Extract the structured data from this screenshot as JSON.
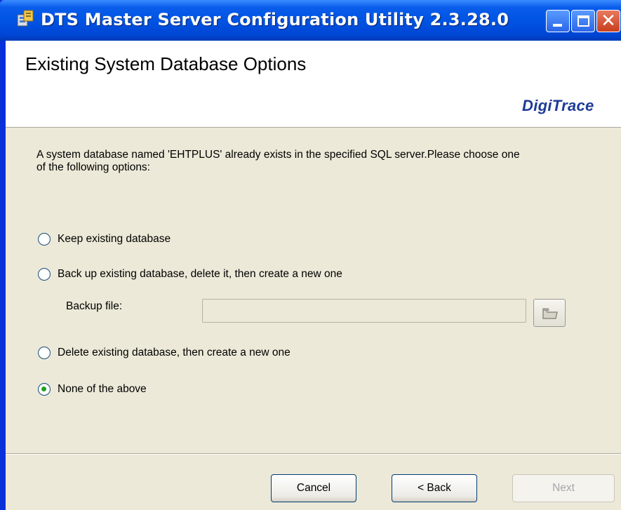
{
  "window": {
    "title": "DTS Master Server Configuration Utility 2.3.28.0",
    "icons": {
      "app": "app-icon",
      "minimize": "minimize-icon",
      "maximize": "maximize-icon",
      "close": "close-icon"
    },
    "close_glyph": "✕"
  },
  "header": {
    "title": "Existing System Database Options",
    "brand": "DigiTrace"
  },
  "intro": {
    "text": "A system database named 'EHTPLUS' already exists in the specified SQL server.Please choose one of the following options:"
  },
  "options": [
    {
      "label": "Keep existing database",
      "selected": false
    },
    {
      "label": "Back up existing database, delete it, then create a new one",
      "selected": false
    },
    {
      "label": "Delete existing database, then create a new one",
      "selected": false
    },
    {
      "label": "None of the above",
      "selected": true
    }
  ],
  "backup": {
    "label": "Backup file:",
    "value": "",
    "enabled": false,
    "browse_icon": "folder-icon"
  },
  "buttons": {
    "cancel": "Cancel",
    "back": "< Back",
    "next": "Next"
  },
  "colors": {
    "titlebar": "#0054E3",
    "dialog_bg": "#ECE9D8",
    "brand": "#1E3C96",
    "radio_selected": "#21A121"
  }
}
